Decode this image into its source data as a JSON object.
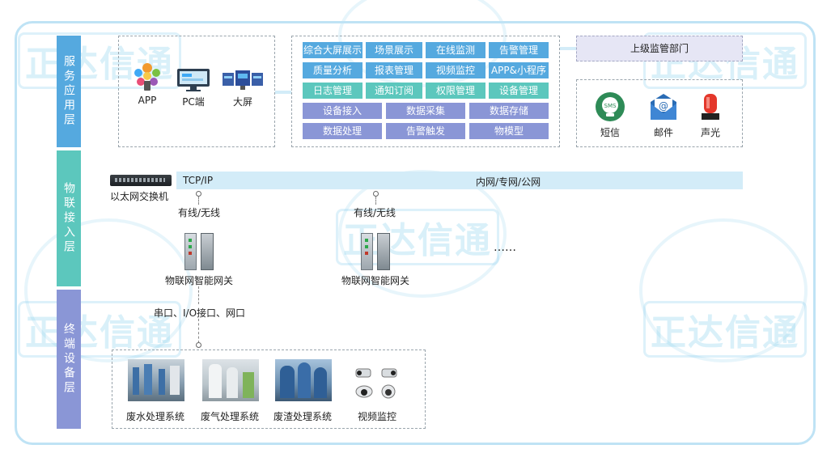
{
  "watermark": "正达信通",
  "layers": {
    "service": "服务应用层",
    "access": "物联接入层",
    "terminal": "终端设备层"
  },
  "clients": [
    {
      "label": "APP",
      "icon": "app-cluster-icon"
    },
    {
      "label": "PC端",
      "icon": "pc-monitor-icon"
    },
    {
      "label": "大屏",
      "icon": "big-screen-icon"
    }
  ],
  "functions": {
    "row1": [
      "综合大屏展示",
      "场景展示",
      "在线监测",
      "告警管理"
    ],
    "row2": [
      "质量分析",
      "报表管理",
      "视频监控",
      "APP&小程序"
    ],
    "row3": [
      "日志管理",
      "通知订阅",
      "权限管理",
      "设备管理"
    ],
    "row4": [
      "设备接入",
      "数据采集",
      "数据存储"
    ],
    "row5": [
      "数据处理",
      "告警触发",
      "物模型"
    ]
  },
  "supervisor": "上级监管部门",
  "notify": [
    {
      "label": "短信",
      "icon": "sms-icon"
    },
    {
      "label": "邮件",
      "icon": "mail-icon"
    },
    {
      "label": "声光",
      "icon": "alarm-light-icon"
    }
  ],
  "network": {
    "switch_label": "以太网交换机",
    "protocol": "TCP/IP",
    "net_types": "内网/专网/公网",
    "link_1": "有线/无线",
    "link_2": "有线/无线",
    "gateway_1": "物联网智能网关",
    "gateway_2": "物联网智能网关",
    "ellipsis": "……",
    "ports": "串口、I/O接口、网口"
  },
  "terminals": [
    {
      "label": "废水处理系统"
    },
    {
      "label": "废气处理系统"
    },
    {
      "label": "废渣处理系统"
    },
    {
      "label": "视频监控"
    }
  ],
  "colors": {
    "service_layer": "#55a9df",
    "access_layer": "#5cc7bd",
    "terminal_layer": "#8a96d6",
    "network_bar": "#d3ecf8",
    "supervisor_box": "#e6e6f5"
  }
}
